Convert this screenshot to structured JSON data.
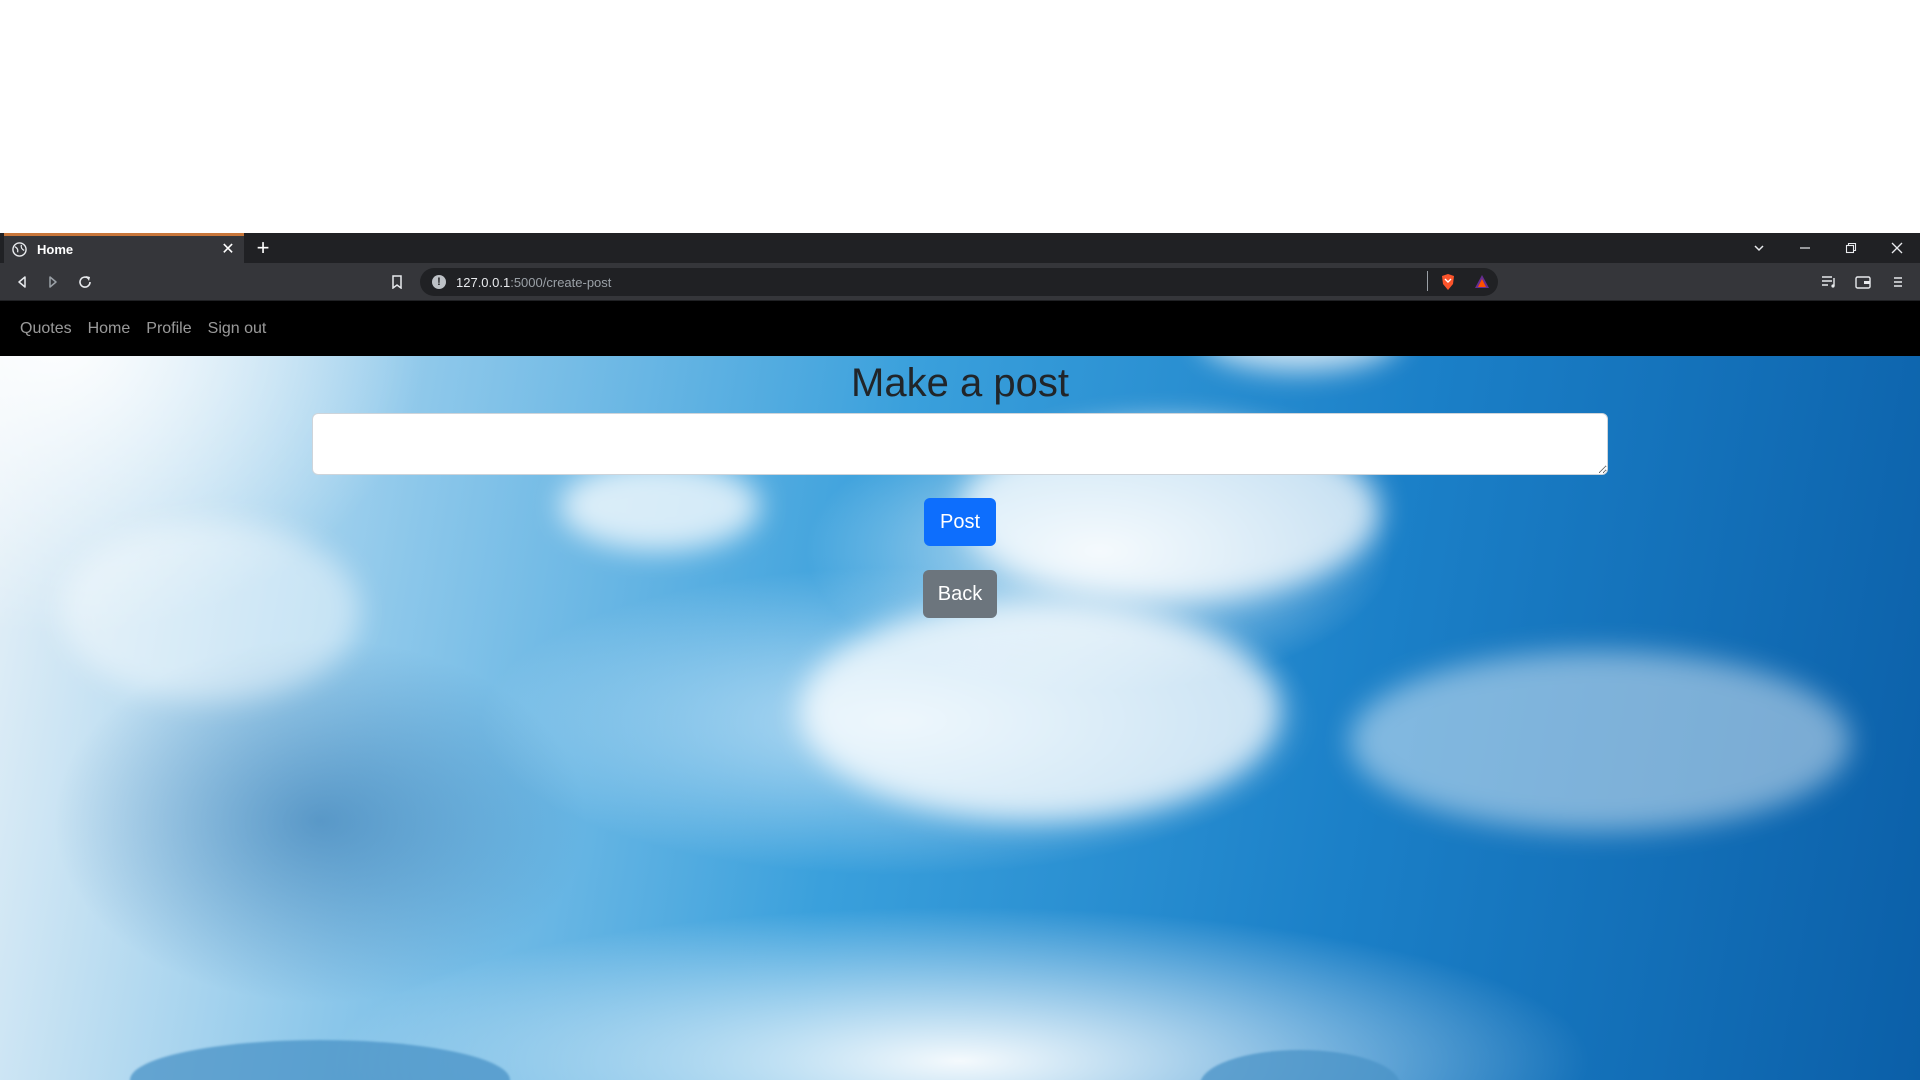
{
  "browser": {
    "tab_title": "Home",
    "tab_close": "✕",
    "new_tab": "+",
    "url_host": "127.0.0.1",
    "url_path": ":5000/create-post",
    "icons": [
      "globe-icon",
      "back-icon",
      "forward-icon",
      "reload-icon",
      "bookmark-icon",
      "info-icon",
      "brave-shield-icon",
      "brave-rewards-icon",
      "playlist-icon",
      "wallet-icon",
      "menu-icon",
      "tab-search-icon",
      "minimize-icon",
      "restore-icon",
      "close-icon"
    ],
    "colors": {
      "tabstrip": "#202124",
      "toolbar": "#35363a",
      "tab_accent": "#c8763a"
    }
  },
  "nav": {
    "links": [
      "Quotes",
      "Home",
      "Profile",
      "Sign out"
    ]
  },
  "main": {
    "title": "Make a post",
    "post_input_value": "",
    "post_button": "Post",
    "back_button": "Back"
  },
  "colors": {
    "primary": "#0d6efd",
    "secondary": "#6c757d",
    "navbar": "#000000"
  }
}
